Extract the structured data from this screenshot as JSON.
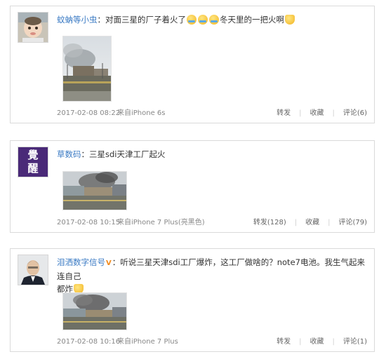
{
  "posts": [
    {
      "username": "蚊蚋等小虫",
      "text_a": "：对面三星的厂子着火了",
      "text_b": "冬天里的一把火啊",
      "emoji_icons": [
        "crying-face-icon",
        "crying-face-icon",
        "crying-face-icon",
        "cat-face-icon"
      ],
      "time": "2017-02-08 08:22",
      "source": "来自iPhone 6s",
      "repost": "转发",
      "favorite": "收藏",
      "comment": "评论(6)"
    },
    {
      "username": "草数码",
      "text_a": "：三星sdi天津工厂起火",
      "avatar_text": "覺醒",
      "time": "2017-02-08 10:15",
      "source": "来自iPhone 7 Plus(亮黑色)",
      "repost": "转发(128)",
      "favorite": "收藏",
      "comment": "评论(79)"
    },
    {
      "username": "泪洒数字信号",
      "text_a": "：听说三星天津sdi工厂爆炸，这工厂做啥的？note7电池。我生气起来连自己",
      "text_b": "都炸",
      "verify_icon": "v-badge-icon",
      "emoji_icons": [
        "cat-face-icon"
      ],
      "time": "2017-02-08 10:16",
      "source": "来自iPhone 7 Plus",
      "repost": "转发",
      "favorite": "收藏",
      "comment": "评论(1)"
    }
  ]
}
